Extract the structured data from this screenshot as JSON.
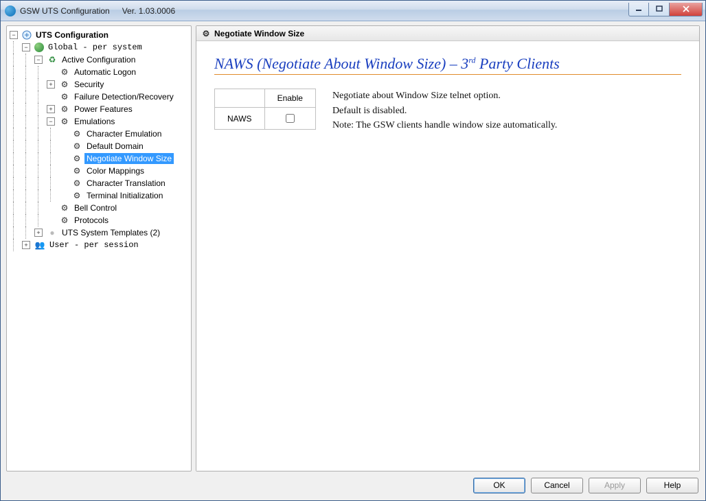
{
  "window": {
    "title": "GSW UTS Configuration",
    "version": "Ver.  1.03.0006"
  },
  "tree": {
    "root": "UTS Configuration",
    "global": "Global  - per system",
    "active_config": "Active Configuration",
    "automatic_logon": "Automatic Logon",
    "security": "Security",
    "failure_detection": "Failure Detection/Recovery",
    "power_features": "Power Features",
    "emulations": "Emulations",
    "character_emulation": "Character Emulation",
    "default_domain": "Default Domain",
    "negotiate_window_size": "Negotiate Window Size",
    "color_mappings": "Color Mappings",
    "character_translation": "Character Translation",
    "terminal_initialization": "Terminal Initialization",
    "bell_control": "Bell Control",
    "protocols": "Protocols",
    "system_templates": "UTS System Templates (2)",
    "user": "User   - per session"
  },
  "right": {
    "header": "Negotiate Window Size",
    "title_pre": "NAWS (Negotiate About Window Size) – 3",
    "title_sup": "rd",
    "title_post": " Party Clients",
    "table": {
      "col_enable": "Enable",
      "row_label": "NAWS"
    },
    "desc_line1": "Negotiate about Window Size telnet option.",
    "desc_line2": "Default is disabled.",
    "desc_line3": "Note: The GSW clients handle window size automatically."
  },
  "footer": {
    "ok": "OK",
    "cancel": "Cancel",
    "apply": "Apply",
    "help": "Help"
  }
}
